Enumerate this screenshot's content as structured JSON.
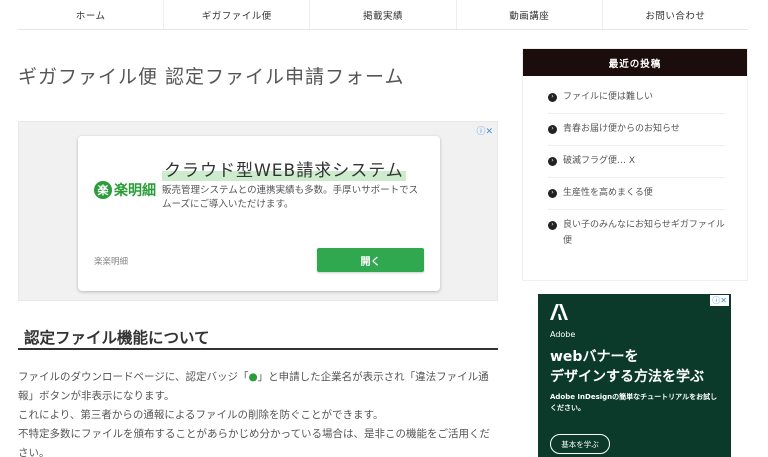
{
  "nav": {
    "items": [
      {
        "label": "ホーム"
      },
      {
        "label": "ギガファイル便"
      },
      {
        "label": "掲載実績"
      },
      {
        "label": "動画講座"
      },
      {
        "label": "お問い合わせ"
      }
    ]
  },
  "page": {
    "title": "ギガファイル便 認定ファイル申請フォーム"
  },
  "ad_main": {
    "choice_icons": "ⓘ✕",
    "headline": "クラウド型WEB請求システム",
    "logo_text": "楽明細",
    "logo_mark": "楽",
    "description": "販売管理システムとの連携実績も多数。手厚いサポートでスムーズにご導入いただけます。",
    "brand": "楽楽明細",
    "open_label": "開く"
  },
  "section": {
    "heading": "認定ファイル機能について"
  },
  "article": {
    "p1_before": "ファイルのダウンロードページに、認定バッジ「",
    "p1_badge": "●",
    "p1_after": "」と申請した企業名が表示され「違法ファイル通報」ボタンが非表示になります。",
    "p2": "これにより、第三者からの通報によるファイルの削除を防ぐことができます。",
    "p3": "不特定多数にファイルを頒布することがあらかじめ分かっている場合は、是非この機能をご活用ください。"
  },
  "sidebar": {
    "widget_title": "最近の投稿",
    "posts": [
      {
        "label": "ファイルに便は難しい"
      },
      {
        "label": "青春お届け便からのお知らせ"
      },
      {
        "label": "破滅フラグ便… X"
      },
      {
        "label": "生産性を高めまくる便"
      },
      {
        "label": "良い子のみんなにお知らせギガファイル便"
      }
    ]
  },
  "side_ad": {
    "choice_icons": "ⓘ✕",
    "brand": "Adobe",
    "headline_1": "webバナーを",
    "headline_2": "デザインする方法を学ぶ",
    "sub": "Adobe InDesignの簡単なチュートリアルをお試しください。",
    "cta": "基本を学ぶ"
  }
}
